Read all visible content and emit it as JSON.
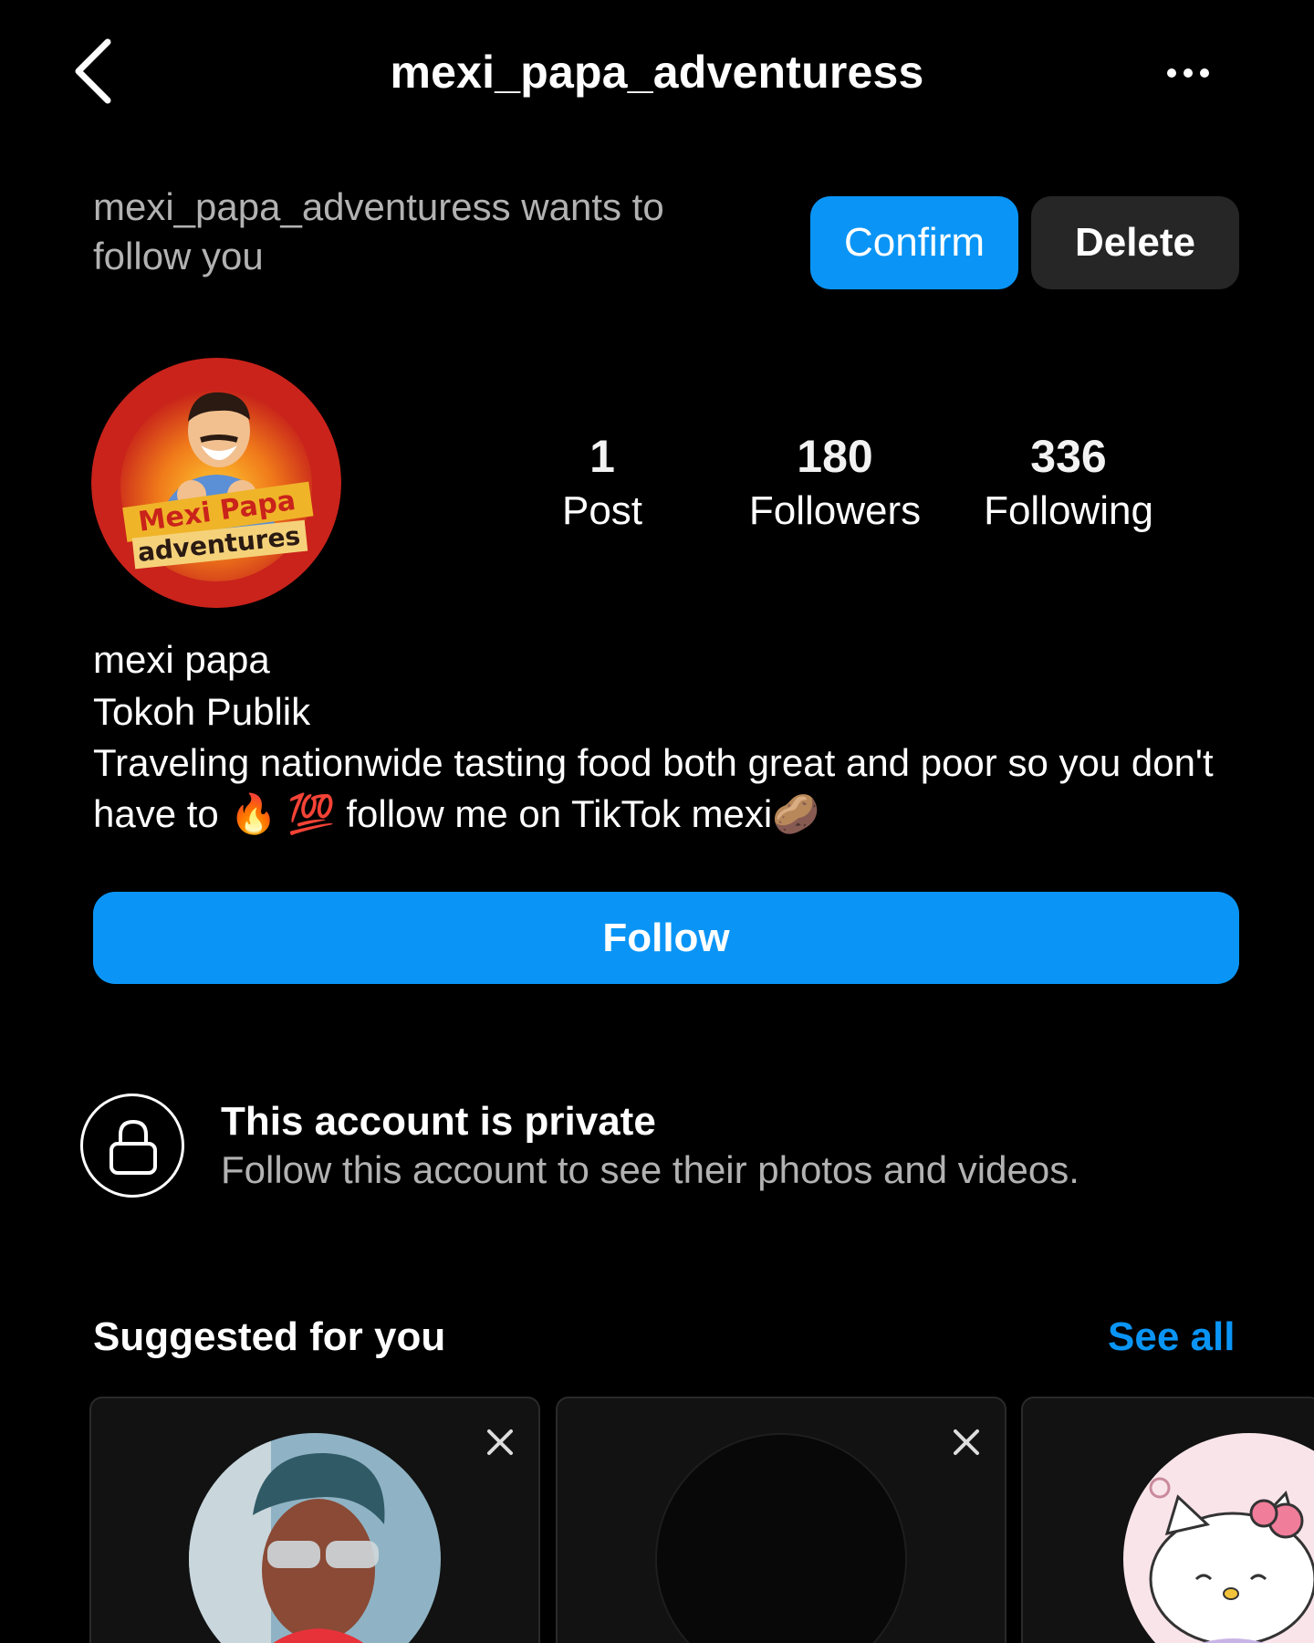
{
  "header": {
    "title": "mexi_papa_adventuress",
    "back_icon": "chevron-left-icon",
    "more_icon": "more-horizontal-icon"
  },
  "follow_request": {
    "text": "mexi_papa_adventuress wants to follow you",
    "confirm_label": "Confirm",
    "delete_label": "Delete"
  },
  "profile": {
    "avatar_logo_text_1": "Mexi Papa",
    "avatar_logo_text_2": "adventures",
    "stats": [
      {
        "value": "1",
        "label": "Post"
      },
      {
        "value": "180",
        "label": "Followers"
      },
      {
        "value": "336",
        "label": "Following"
      }
    ],
    "name": "mexi papa",
    "category": "Tokoh Publik",
    "bio": "Traveling nationwide tasting food both great and poor so you don't have to 🔥 💯 follow me on TikTok mexi🥔",
    "follow_label": "Follow"
  },
  "private_notice": {
    "icon": "lock-icon",
    "title": "This account is private",
    "subtitle": "Follow this account to see their photos and videos."
  },
  "suggested": {
    "title": "Suggested for you",
    "see_all_label": "See all",
    "close_icon": "close-icon"
  },
  "colors": {
    "accent": "#0a95f6",
    "background": "#000000",
    "secondary_button": "#262626",
    "muted_text": "#b2b2b2"
  }
}
